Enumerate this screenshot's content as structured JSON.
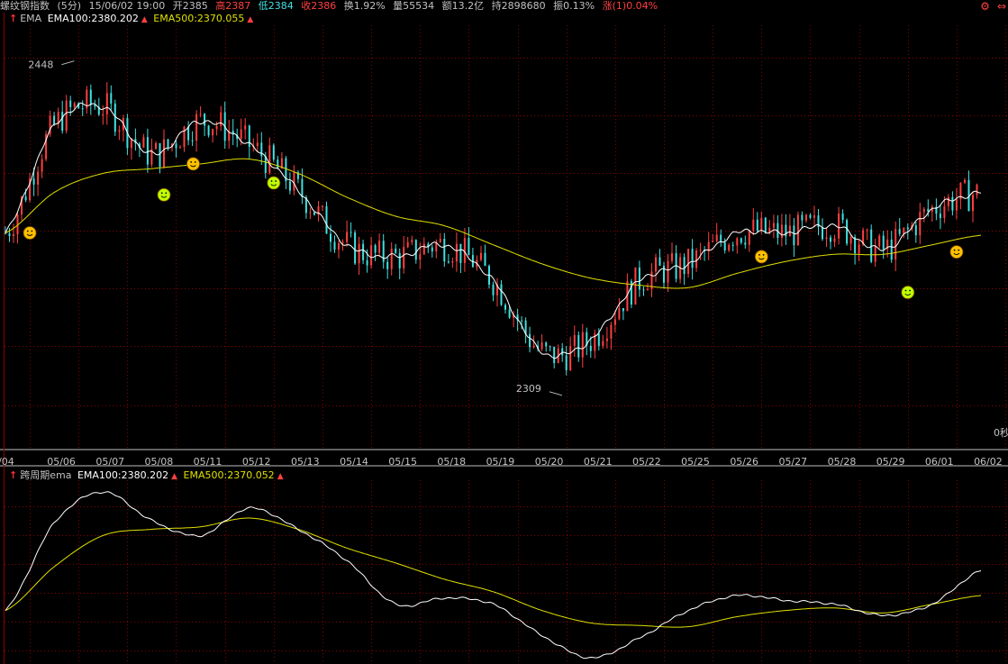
{
  "header": {
    "name": "螺纹钢指数",
    "period": "(5分)",
    "datetime": "15/06/02 19:00",
    "open": "开2385",
    "high": "高2387",
    "low": "低2384",
    "close": "收2386",
    "turnover": "换1.92%",
    "volume": "量55534",
    "amount": "额13.2亿",
    "hold": "持2898680",
    "amplitude": "振0.13%",
    "change": "涨(1)0.04%"
  },
  "top_icons": [
    "gear-icon",
    "link-icon"
  ],
  "main_legend": {
    "name": "EMA",
    "ema100": "EMA100:2380.202",
    "ema500": "EMA500:2370.055"
  },
  "sub_legend": {
    "name": "跨周期ema",
    "ema100": "EMA100:2380.202",
    "ema500": "EMA500:2370.052"
  },
  "colors": {
    "up": "#ff4040",
    "down": "#40e0e0",
    "ema_fast": "#ffffff",
    "ema_slow": "#e0e000",
    "grid": "#8b0000",
    "label": "#c0c0c0"
  },
  "chart_data": [
    {
      "type": "line",
      "title": "EMA",
      "x": [
        "/04",
        "05/06",
        "05/07",
        "05/08",
        "05/11",
        "05/12",
        "05/13",
        "05/14",
        "05/15",
        "05/18",
        "05/19",
        "05/20",
        "05/21",
        "05/22",
        "05/25",
        "05/26",
        "05/27",
        "05/28",
        "05/29",
        "06/01",
        "06/02"
      ],
      "ylim": [
        2290,
        2460
      ],
      "annotations": [
        {
          "label": "2448",
          "x": "05/06",
          "y": 2448
        },
        {
          "label": "2309",
          "x": "05/20",
          "y": 2309
        }
      ],
      "right_label": "0秒",
      "series": [
        {
          "name": "EMA100",
          "values": [
            2375,
            2420,
            2428,
            2408,
            2422,
            2412,
            2393,
            2370,
            2365,
            2370,
            2355,
            2325,
            2330,
            2355,
            2362,
            2375,
            2375,
            2378,
            2368,
            2385,
            2392
          ]
        },
        {
          "name": "EMA500",
          "values": [
            2375,
            2392,
            2400,
            2402,
            2404,
            2406,
            2400,
            2390,
            2382,
            2378,
            2370,
            2362,
            2356,
            2353,
            2352,
            2358,
            2363,
            2366,
            2366,
            2370,
            2374
          ]
        }
      ],
      "markers": [
        {
          "x": "/04",
          "y": 2375,
          "color": "#ffc000"
        },
        {
          "x": "05/08",
          "y": 2391,
          "color": "#c0ff00"
        },
        {
          "x": "05/08",
          "y": 2404,
          "color": "#ffc000"
        },
        {
          "x": "05/12",
          "y": 2396,
          "color": "#c0ff00"
        },
        {
          "x": "05/26",
          "y": 2365,
          "color": "#ffc000"
        },
        {
          "x": "05/29",
          "y": 2350,
          "color": "#c0ff00"
        },
        {
          "x": "06/01",
          "y": 2367,
          "color": "#ffc000"
        }
      ]
    },
    {
      "type": "line",
      "title": "跨周期ema",
      "x": [
        "/04",
        "05/06",
        "05/07",
        "05/08",
        "05/11",
        "05/12",
        "05/13",
        "05/14",
        "05/15",
        "05/18",
        "05/19",
        "05/20",
        "05/21",
        "05/22",
        "05/25",
        "05/26",
        "05/27",
        "05/28",
        "05/29",
        "06/01",
        "06/02"
      ],
      "ylim": [
        2300,
        2440
      ],
      "series": [
        {
          "name": "EMA100",
          "values": [
            2340,
            2410,
            2435,
            2412,
            2400,
            2422,
            2405,
            2380,
            2345,
            2350,
            2345,
            2320,
            2302,
            2318,
            2340,
            2352,
            2348,
            2345,
            2336,
            2345,
            2372
          ]
        },
        {
          "name": "EMA500",
          "values": [
            2340,
            2375,
            2400,
            2405,
            2407,
            2414,
            2405,
            2390,
            2378,
            2365,
            2355,
            2340,
            2330,
            2328,
            2327,
            2335,
            2340,
            2342,
            2338,
            2345,
            2352
          ]
        }
      ]
    }
  ]
}
